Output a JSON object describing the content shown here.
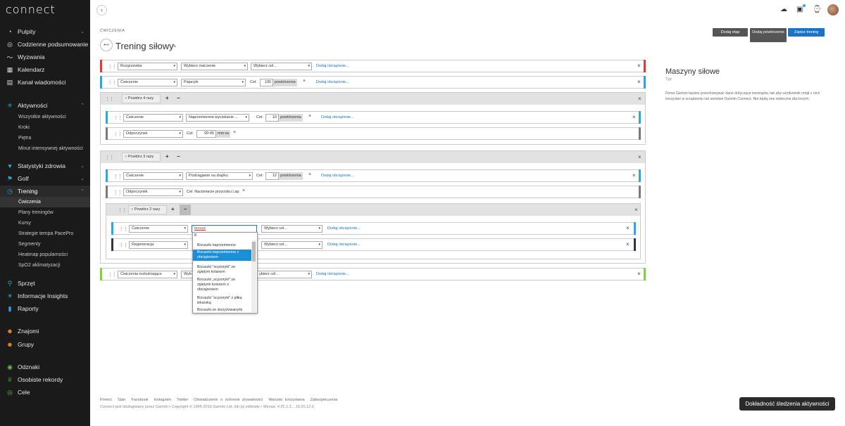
{
  "app": {
    "logo": "connect"
  },
  "sidebar": {
    "items": [
      {
        "label": "Pulpity",
        "icon": "dashboard-icon",
        "chevron": true
      },
      {
        "label": "Codzienne podsumowanie",
        "icon": "summary-icon"
      },
      {
        "label": "Wyzwania",
        "icon": "challenge-icon"
      },
      {
        "label": "Kalendarz",
        "icon": "calendar-icon"
      },
      {
        "label": "Kanał wiadomości",
        "icon": "newsfeed-icon"
      },
      {
        "label": "Aktywności",
        "icon": "activity-icon",
        "chevron": true
      },
      {
        "label": "Wszystkie aktywności"
      },
      {
        "label": "Kroki"
      },
      {
        "label": "Piętra"
      },
      {
        "label": "Minut intensywnej aktywności"
      },
      {
        "label": "Statystyki zdrowia",
        "icon": "health-icon",
        "chevron": true
      },
      {
        "label": "Golf",
        "icon": "golf-icon",
        "chevron": true
      },
      {
        "label": "Trening",
        "icon": "training-icon",
        "chevron": true
      },
      {
        "label": "Ćwiczenia"
      },
      {
        "label": "Plany treningów"
      },
      {
        "label": "Kursy"
      },
      {
        "label": "Strategie tempa PacePro"
      },
      {
        "label": "Segmenty"
      },
      {
        "label": "Heatmap popularności"
      },
      {
        "label": "SpO2 aklimatyzacji"
      },
      {
        "label": "Sprzęt",
        "icon": "gear-icon"
      },
      {
        "label": "Informacje Insights",
        "icon": "insights-icon"
      },
      {
        "label": "Raporty",
        "icon": "reports-icon"
      },
      {
        "label": "Znajomi",
        "icon": "friends-icon"
      },
      {
        "label": "Grupy",
        "icon": "groups-icon"
      },
      {
        "label": "Odznaki",
        "icon": "badges-icon"
      },
      {
        "label": "Osobiste rekordy",
        "icon": "records-icon"
      },
      {
        "label": "Cele",
        "icon": "goals-icon"
      }
    ]
  },
  "header": {
    "breadcrumb": "ĆWICZENIA",
    "title": "Trening siłowy",
    "buttons": {
      "add_step": "Dodaj etap",
      "add_repeat": "Dodaj powtórzenie",
      "save": "Zapisz trening"
    }
  },
  "steps": {
    "warmup": {
      "type": "Rozgrzewka",
      "exercise": "Wybierz ćwiczenie",
      "target": "Wybierz cel...",
      "add_load": "Dodaj obciążenie..."
    },
    "exercise1": {
      "type": "Ćwiczenie",
      "exercise": "Pajacyki",
      "target_label": "Cel:",
      "target_value": "100",
      "unit": "powtórzenia",
      "add_load": "Dodaj obciążenie..."
    },
    "repeat1": {
      "label": "Powtórz 4 razy"
    },
    "r1_ex": {
      "type": "Ćwiczenie",
      "exercise": "Naprzemienne wyciskanie ...",
      "target_label": "Cel:",
      "target_value": "10",
      "unit": "powtórzenia",
      "add_load": "Dodaj obciążenie..."
    },
    "r1_rest": {
      "type": "Odpoczynek",
      "target_label": "Cel:",
      "target_value": "00:45",
      "unit": "mm:ss"
    },
    "repeat2": {
      "label": "Powtórz 3 razy"
    },
    "r2_ex": {
      "type": "Ćwiczenie",
      "exercise": "Podciąganie na drążku",
      "target_label": "Cel:",
      "target_value": "12",
      "unit": "powtórzenia",
      "add_load": "Dodaj obciążenie..."
    },
    "r2_rest": {
      "type": "Odpoczynek",
      "target_text": "Cel: Naciśnięcie przycisku Lap"
    },
    "repeat3": {
      "label": "Powtórz 2 razy"
    },
    "r3_ex": {
      "type": "Ćwiczenie",
      "exercise": "brzusz",
      "target": "Wybierz cel...",
      "add_load": "Dodaj obciążenie..."
    },
    "r3_rec": {
      "type": "Regeneracja",
      "target": "Wybierz cel...",
      "add_load": "Dodaj obciążenie..."
    },
    "cooldown": {
      "type": "Ćwiczenia rozluźniające",
      "exercise": "Wyb",
      "target": "ybierz cel...",
      "add_load": "Dodaj obciążenie..."
    }
  },
  "dropdown": {
    "search": "8",
    "items": [
      "Brzuszki naprzemienne",
      "Brzuszki naprzemienne z obciążeniem",
      "Brzuszki \"scyzoryki\" ze zgiętym kolanem",
      "Brzuszki „scyzoryki\" ze zgiętymi kolanem z obciążeniem",
      "Brzuszki \"scyzoryki\" z piłką lekarską",
      "Brzuszki ze skrzyżowanymi"
    ],
    "highlighted": 1
  },
  "side_panel": {
    "title": "Maszyny siłowe",
    "subtitle": "Typ",
    "text": "Firma Garmin będzie przechowywać dane dotyczące treningów, tak aby użytkownik mógł z nich korzystać w urządzeniu lub serwisie Garmin Connect. Nie będą one widoczne dla innych."
  },
  "footer": {
    "links": [
      "Pomoc",
      "Stan",
      "Facebook",
      "Instagram",
      "Twitter",
      "Oświadczenie o ochronie prywatności",
      "Warunki korzystania",
      "Zabezpieczenia"
    ],
    "copyright": "Connect jest obsługiwany przez Garmin • Copyright © 1996-2019 Garmin Ltd. lub jej oddziały • Wersja: 4.25.1.2... 19.20.12.0",
    "accuracy_button": "Dokładność śledzenia aktywności"
  },
  "colors": {
    "warmup": "#e53935",
    "exercise": "#29a8e0",
    "rest": "#7a7a7a",
    "recovery": "#2a3a4a",
    "cooldown": "#7fd33a",
    "accent": "#1a73c8"
  }
}
